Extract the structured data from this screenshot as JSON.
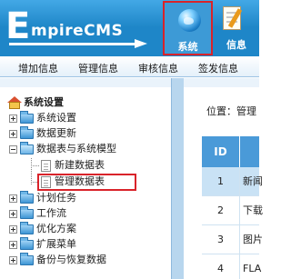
{
  "header": {
    "logo_initial": "E",
    "logo_rest": "mpireCMS",
    "nav": [
      {
        "label": "系统",
        "active": true,
        "icon": "globe-icon"
      },
      {
        "label": "信息",
        "active": false,
        "icon": "notepad-icon"
      }
    ]
  },
  "menu": [
    "增加信息",
    "管理信息",
    "审核信息",
    "签发信息"
  ],
  "tree": {
    "root": "系统设置",
    "items": [
      {
        "label": "系统设置",
        "expanded": false
      },
      {
        "label": "数据更新",
        "expanded": false
      },
      {
        "label": "数据表与系统模型",
        "expanded": true
      },
      {
        "label": "计划任务",
        "expanded": false
      },
      {
        "label": "工作流",
        "expanded": false
      },
      {
        "label": "优化方案",
        "expanded": false
      },
      {
        "label": "扩展菜单",
        "expanded": false
      },
      {
        "label": "备份与恢复数据",
        "expanded": false
      }
    ],
    "children": [
      {
        "label": "新建数据表"
      },
      {
        "label": "管理数据表",
        "highlighted": true
      }
    ]
  },
  "content": {
    "location_label": "位置：管理",
    "table_header_id": "ID",
    "rows": [
      {
        "id": "1",
        "title": "新闻"
      },
      {
        "id": "2",
        "title": "下载"
      },
      {
        "id": "3",
        "title": "图片"
      },
      {
        "id": "4",
        "title": "FLA"
      }
    ]
  },
  "colors": {
    "banner": "#1e86c8",
    "highlight_border": "#d9232a",
    "table_header": "#4a9ad8",
    "selected_row": "#c9e2f5"
  }
}
